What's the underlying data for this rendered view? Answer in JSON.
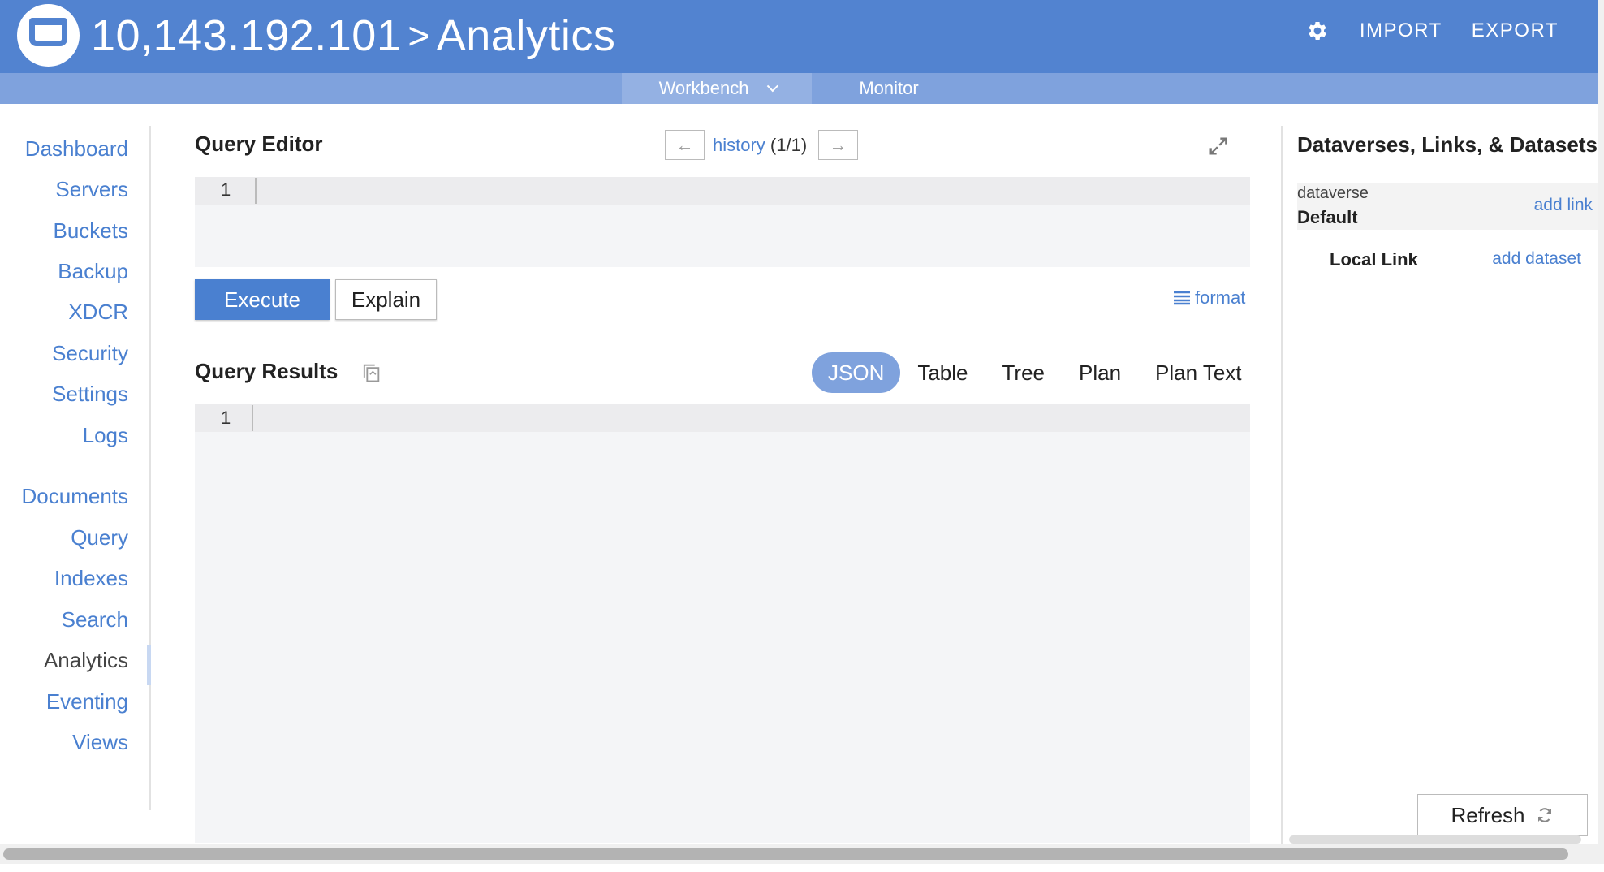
{
  "header": {
    "breadcrumb_cluster": "10,143.192.101",
    "breadcrumb_separator": ">",
    "breadcrumb_page": "Analytics",
    "import_label": "IMPORT",
    "export_label": "EXPORT",
    "icons": {
      "settings": "gear-icon",
      "logo": "couchbase-logo"
    }
  },
  "subnav": {
    "tabs": [
      {
        "label": "Workbench",
        "active": true,
        "has_dropdown": true
      },
      {
        "label": "Monitor",
        "active": false
      }
    ]
  },
  "sidebar": {
    "items": [
      {
        "label": "Dashboard"
      },
      {
        "label": "Servers"
      },
      {
        "label": "Buckets"
      },
      {
        "label": "Backup"
      },
      {
        "label": "XDCR"
      },
      {
        "label": "Security"
      },
      {
        "label": "Settings"
      },
      {
        "label": "Logs"
      },
      {
        "label": "Documents"
      },
      {
        "label": "Query"
      },
      {
        "label": "Indexes"
      },
      {
        "label": "Search"
      },
      {
        "label": "Analytics",
        "current": true
      },
      {
        "label": "Eventing"
      },
      {
        "label": "Views"
      }
    ]
  },
  "editor": {
    "title": "Query Editor",
    "history_link": "history",
    "history_count": "(1/1)",
    "prev_symbol": "←",
    "next_symbol": "→",
    "line_number": "1",
    "execute_label": "Execute",
    "explain_label": "Explain",
    "format_label": "format"
  },
  "results": {
    "title": "Query Results",
    "tabs": [
      {
        "label": "JSON",
        "active": true
      },
      {
        "label": "Table"
      },
      {
        "label": "Tree"
      },
      {
        "label": "Plan"
      },
      {
        "label": "Plan Text"
      }
    ],
    "line_number": "1"
  },
  "right_panel": {
    "title": "Dataverses, Links, & Datasets",
    "dataverse_label": "dataverse",
    "dataverse_name": "Default",
    "add_link_label": "add link",
    "link_name": "Local Link",
    "add_dataset_label": "add dataset",
    "refresh_label": "Refresh"
  },
  "colors": {
    "header_bg": "#5283d0",
    "subnav_bg": "#7fa2dd",
    "accent": "#4a80d0",
    "editor_bg": "#f4f5f7"
  }
}
